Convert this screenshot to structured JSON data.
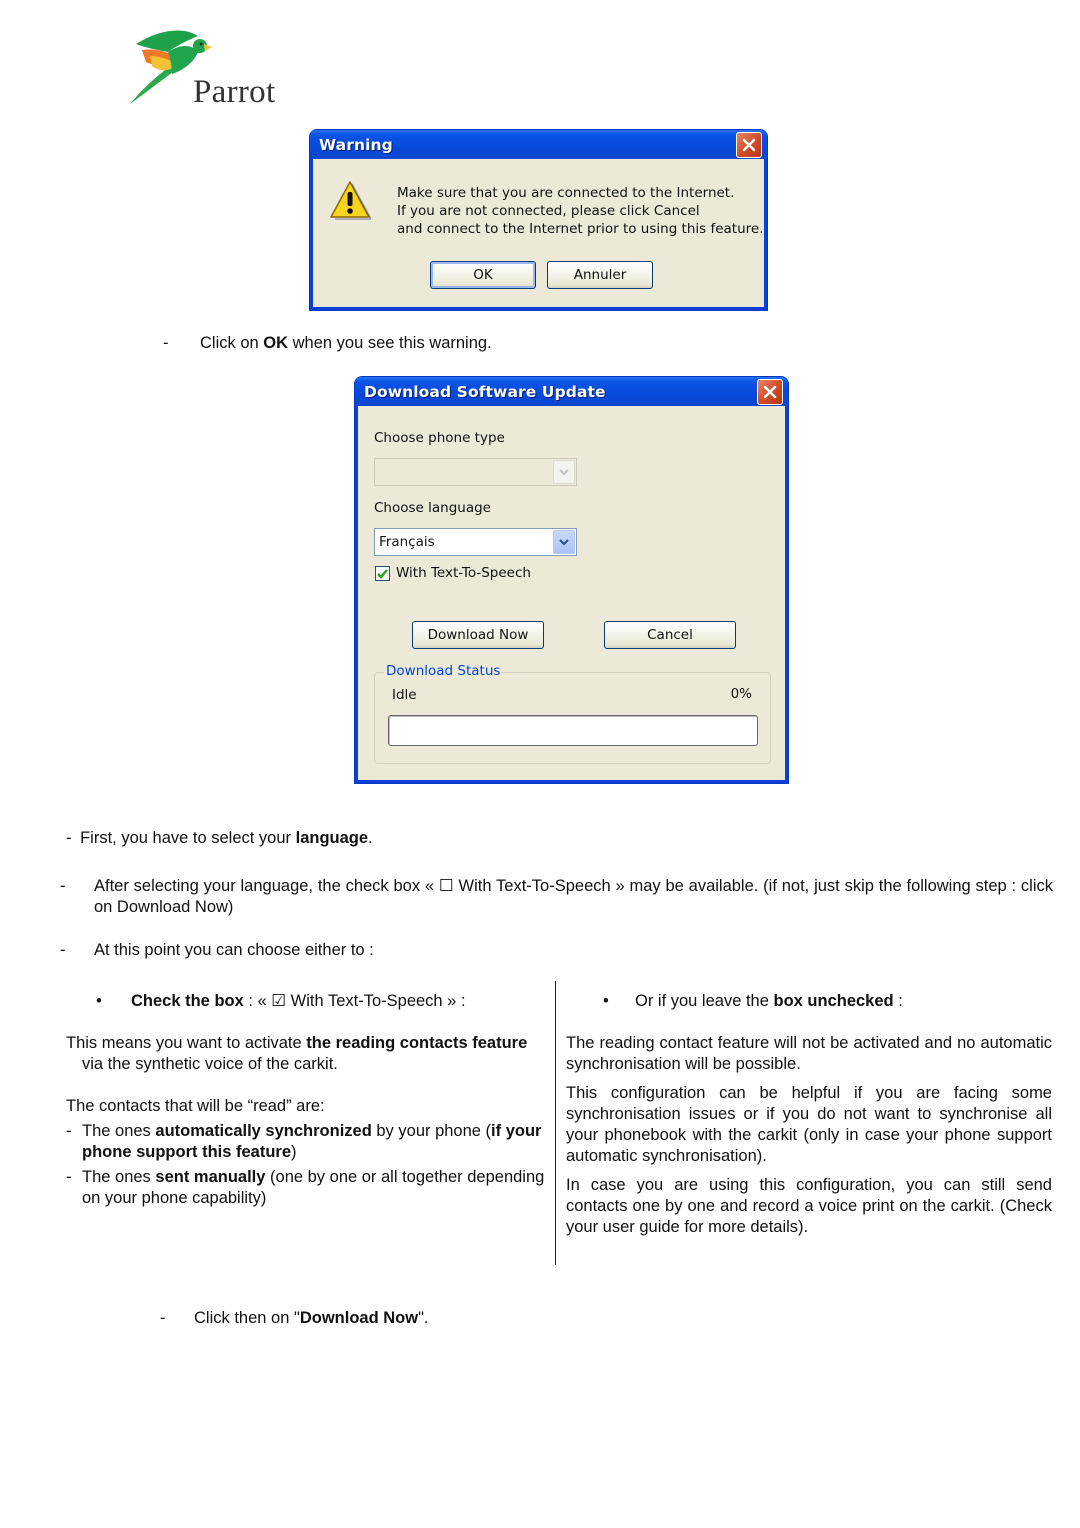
{
  "logo": {
    "brand_name": "Parrot",
    "icon": "parrot-bird-logo"
  },
  "warning_dialog": {
    "title": "Warning",
    "icon": "warning-triangle-icon",
    "message_lines": [
      "Make sure that you are connected to the Internet.",
      "If you are not connected, please click Cancel",
      "and connect to the Internet prior to using this feature."
    ],
    "ok_label": "OK",
    "cancel_label": "Annuler",
    "close_icon": "close-icon"
  },
  "step_click_ok": {
    "bullet": "-",
    "pre": "Click on ",
    "bold": "OK",
    "post": " when you see this warning."
  },
  "download_dialog": {
    "title": "Download Software Update",
    "phone_type_label": "Choose phone type",
    "phone_type_value": "",
    "language_label": "Choose language",
    "language_value": "Français",
    "tts_checkbox_label": "With Text-To-Speech",
    "tts_checked": true,
    "download_now_label": "Download Now",
    "cancel_label": "Cancel",
    "status_group_label": "Download Status",
    "status_text": "Idle",
    "progress_text": "0%",
    "progress_value": 0
  },
  "instructions": {
    "select_language": {
      "bullet": "-",
      "pre": "First, you have to select your ",
      "bold": "language",
      "post": "."
    },
    "after_selecting": {
      "bullet": "-",
      "text": "After selecting your language, the check box « ☐ With Text-To-Speech » may be available. (if not, just skip the following step : click on Download Now)"
    },
    "choose_either": {
      "bullet": "-",
      "text": "At this point you can choose either to :"
    }
  },
  "left_column": {
    "bullet": "•",
    "heading_bold": "Check the box",
    "heading_rest": " : « ☑ With Text-To-Speech » :",
    "para1_pre": "This means you want to activate ",
    "para1_bold": "the reading contacts feature",
    "para1_post": " via the synthetic voice of the carkit.",
    "para2": "The contacts that will be “read” are:",
    "items": [
      {
        "pre": "The ones ",
        "bold": "automatically synchronized",
        "mid": " by your phone (",
        "bold2": "if your phone support this feature",
        "post": ")"
      },
      {
        "pre": "The ones ",
        "bold": "sent manually",
        "post": " (one by one or all together depending on your phone capability)"
      }
    ]
  },
  "right_column": {
    "bullet": "•",
    "heading_pre": "Or if you leave the ",
    "heading_bold": "box unchecked",
    "heading_post": " :",
    "paragraphs": [
      "The reading contact feature will not be activated and no automatic synchronisation will be possible.",
      "This configuration can be helpful if you are facing some synchronisation issues or if you do not want to synchronise all your phonebook with the carkit (only in case your phone support automatic synchronisation).",
      "In case you are using this configuration, you can still send contacts one by one and record a voice print on the carkit. (Check your user guide for more details)."
    ]
  },
  "final_step": {
    "bullet": "-",
    "pre": "Click then on \"",
    "bold": "Download Now",
    "post": "\"."
  }
}
